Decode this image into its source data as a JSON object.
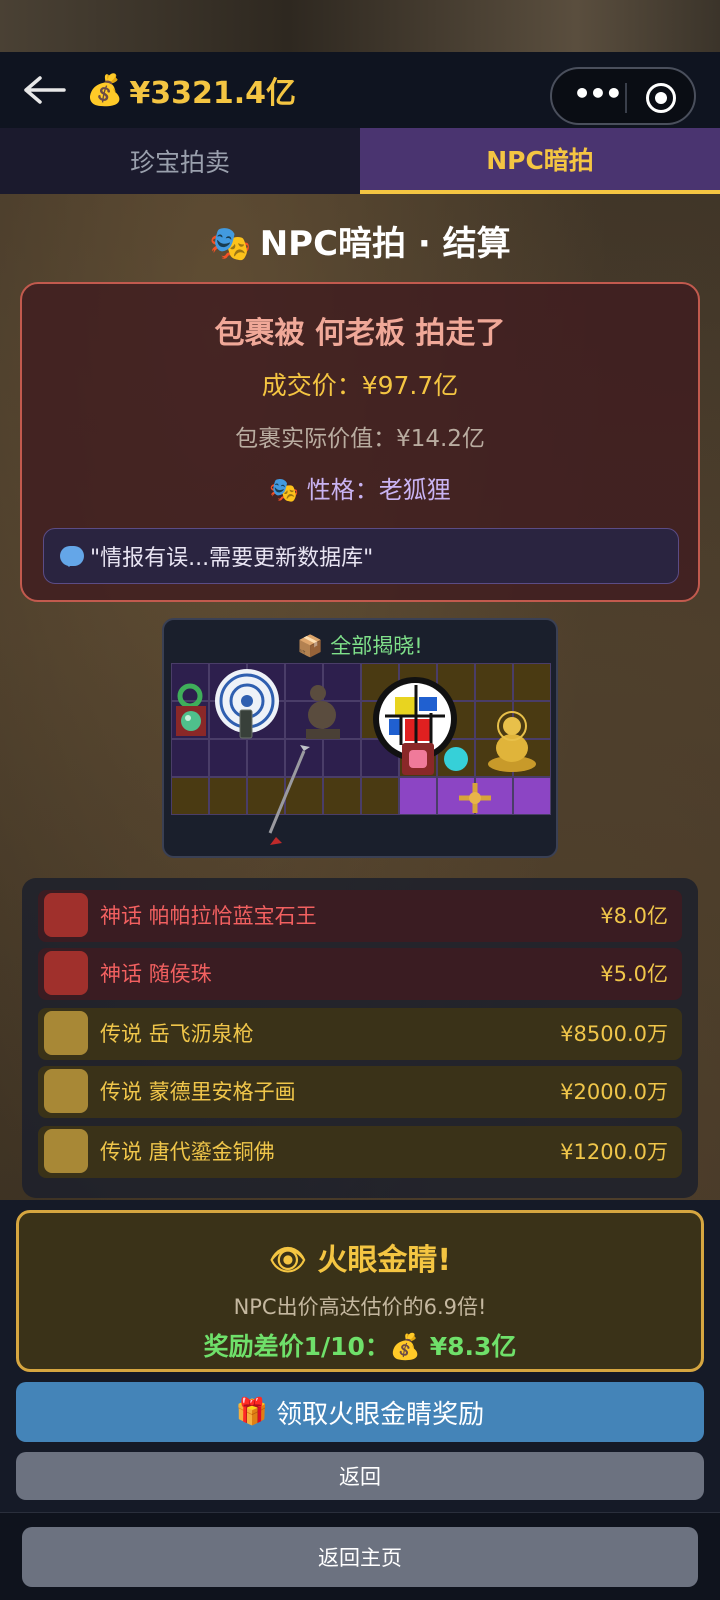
{
  "header": {
    "balance": "¥3321.4亿"
  },
  "tabs": [
    {
      "label": "珍宝拍卖"
    },
    {
      "label": "NPC暗拍"
    }
  ],
  "page_title": "NPC暗拍 · 结算",
  "result": {
    "winner": "包裹被 何老板 拍走了",
    "deal_price": "成交价：¥97.7亿",
    "actual_value": "包裹实际价值：¥14.2亿",
    "personality": "性格：老狐狸",
    "quote": "\"情报有误...需要更新数据库\""
  },
  "reveal": {
    "title": "全部揭晓!"
  },
  "items": [
    {
      "tier": "神话",
      "name": "帕帕拉恰蓝宝石王",
      "price": "¥8.0亿"
    },
    {
      "tier": "神话",
      "name": "随侯珠",
      "price": "¥5.0亿"
    },
    {
      "tier": "传说",
      "name": "岳飞沥泉枪",
      "price": "¥8500.0万"
    },
    {
      "tier": "传说",
      "name": "蒙德里安格子画",
      "price": "¥2000.0万"
    },
    {
      "tier": "传说",
      "name": "唐代鎏金铜佛",
      "price": "¥1200.0万"
    }
  ],
  "reward": {
    "title": "火眼金睛!",
    "subtitle": "NPC出价高达估价的6.9倍!",
    "reward_label": "奖励差价1/10：",
    "reward_value": "¥8.3亿"
  },
  "buttons": {
    "claim": "领取火眼金睛奖励",
    "back": "返回",
    "home": "返回主页"
  }
}
